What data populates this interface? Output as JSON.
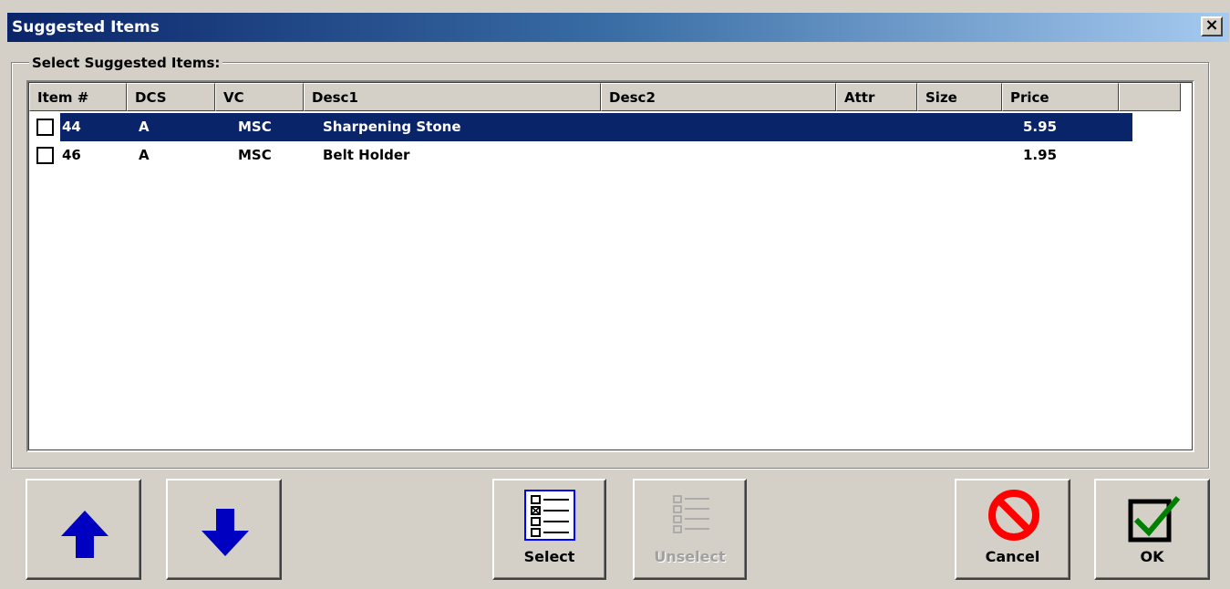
{
  "window": {
    "title": "Suggested Items",
    "close_label": "×"
  },
  "group": {
    "label": "Select Suggested Items:"
  },
  "columns": [
    {
      "label": "Item #"
    },
    {
      "label": "DCS"
    },
    {
      "label": "VC"
    },
    {
      "label": "Desc1"
    },
    {
      "label": "Desc2"
    },
    {
      "label": "Attr"
    },
    {
      "label": "Size"
    },
    {
      "label": "Price"
    }
  ],
  "rows": [
    {
      "item": "44",
      "dcs": "A",
      "vc": "MSC",
      "desc1": "Sharpening Stone",
      "desc2": "",
      "attr": "",
      "size": "",
      "price": "5.95",
      "selected": true,
      "checked": false
    },
    {
      "item": "46",
      "dcs": "A",
      "vc": "MSC",
      "desc1": "Belt Holder",
      "desc2": "",
      "attr": "",
      "size": "",
      "price": "1.95",
      "selected": false,
      "checked": false
    }
  ],
  "buttons": {
    "up": {
      "icon": "arrow-up-icon",
      "color": "#0000c0"
    },
    "down": {
      "icon": "arrow-down-icon",
      "color": "#0000c0"
    },
    "select": {
      "label": "Select",
      "icon": "checklist-icon"
    },
    "unselect": {
      "label": "Unselect",
      "icon": "checklist-icon",
      "disabled": true
    },
    "cancel": {
      "label": "Cancel",
      "icon": "no-entry-icon",
      "color": "#ff0000"
    },
    "ok": {
      "label": "OK",
      "icon": "checkmark-box-icon",
      "color": "#008000"
    }
  },
  "colors": {
    "selection": "#0a246a",
    "face": "#d4d0c8"
  }
}
